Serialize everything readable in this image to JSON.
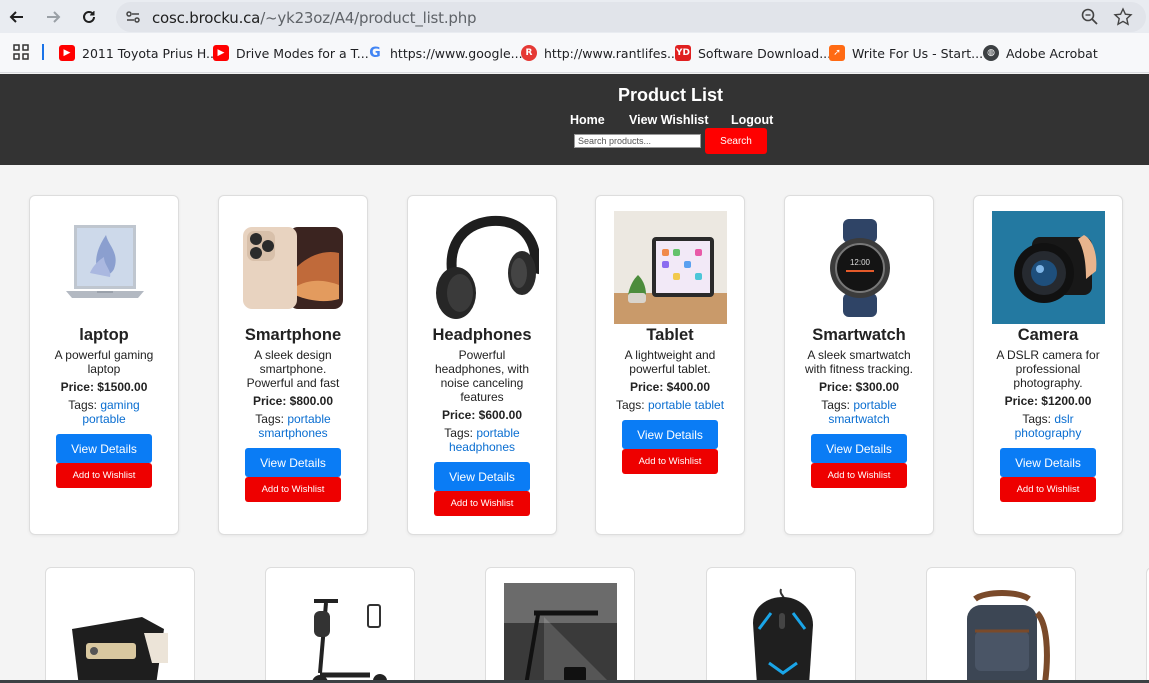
{
  "browser": {
    "url_host": "cosc.brocku.ca",
    "url_path": "/~yk23oz/A4/product_list.php",
    "bookmarks": [
      {
        "label": "2011 Toyota Prius H...",
        "icon": "youtube-icon",
        "color": "#ff0000"
      },
      {
        "label": "Drive Modes for a T...",
        "icon": "youtube-icon",
        "color": "#ff0000"
      },
      {
        "label": "https://www.google...",
        "icon": "google-icon",
        "color": "#4285f4"
      },
      {
        "label": "http://www.rantlifes...",
        "icon": "rantlife-icon",
        "color": "#e53935"
      },
      {
        "label": "Software Download...",
        "icon": "yd-icon",
        "color": "#e02020"
      },
      {
        "label": "Write For Us - Start...",
        "icon": "rocket-icon",
        "color": "#ff6a13"
      },
      {
        "label": "Adobe Acrobat",
        "icon": "globe-icon",
        "color": "#3c4043"
      }
    ]
  },
  "header": {
    "title": "Product List",
    "nav": [
      "Home",
      "View Wishlist",
      "Logout"
    ],
    "search_placeholder": "Search products...",
    "search_button": "Search"
  },
  "buttons": {
    "view_details": "View Details",
    "add_to_wishlist": "Add to Wishlist"
  },
  "products": [
    {
      "name": "laptop",
      "description": "A powerful gaming laptop",
      "price": "Price: $1500.00",
      "tags_label": "Tags:",
      "tags": "gaming portable",
      "image": "laptop-image"
    },
    {
      "name": "Smartphone",
      "description": "A sleek design smartphone. Powerful and fast",
      "price": "Price: $800.00",
      "tags_label": "Tags:",
      "tags": "portable smartphones",
      "image": "smartphone-image"
    },
    {
      "name": "Headphones",
      "description": "Powerful headphones, with noise canceling features",
      "price": "Price: $600.00",
      "tags_label": "Tags:",
      "tags": "portable headphones",
      "image": "headphones-image"
    },
    {
      "name": "Tablet",
      "description": "A lightweight and powerful tablet.",
      "price": "Price: $400.00",
      "tags_label": "Tags:",
      "tags": "portable tablet",
      "image": "tablet-image"
    },
    {
      "name": "Smartwatch",
      "description": "A sleek smartwatch with fitness tracking.",
      "price": "Price: $300.00",
      "tags_label": "Tags:",
      "tags": "portable smartwatch",
      "image": "smartwatch-image"
    },
    {
      "name": "Camera",
      "description": "A DSLR camera for professional photography.",
      "price": "Price: $1200.00",
      "tags_label": "Tags:",
      "tags": "dslr photography",
      "image": "camera-image"
    }
  ],
  "second_row_images": [
    "speaker-image",
    "scooter-image",
    "desk-lamp-image",
    "gaming-mouse-image",
    "backpack-image"
  ]
}
